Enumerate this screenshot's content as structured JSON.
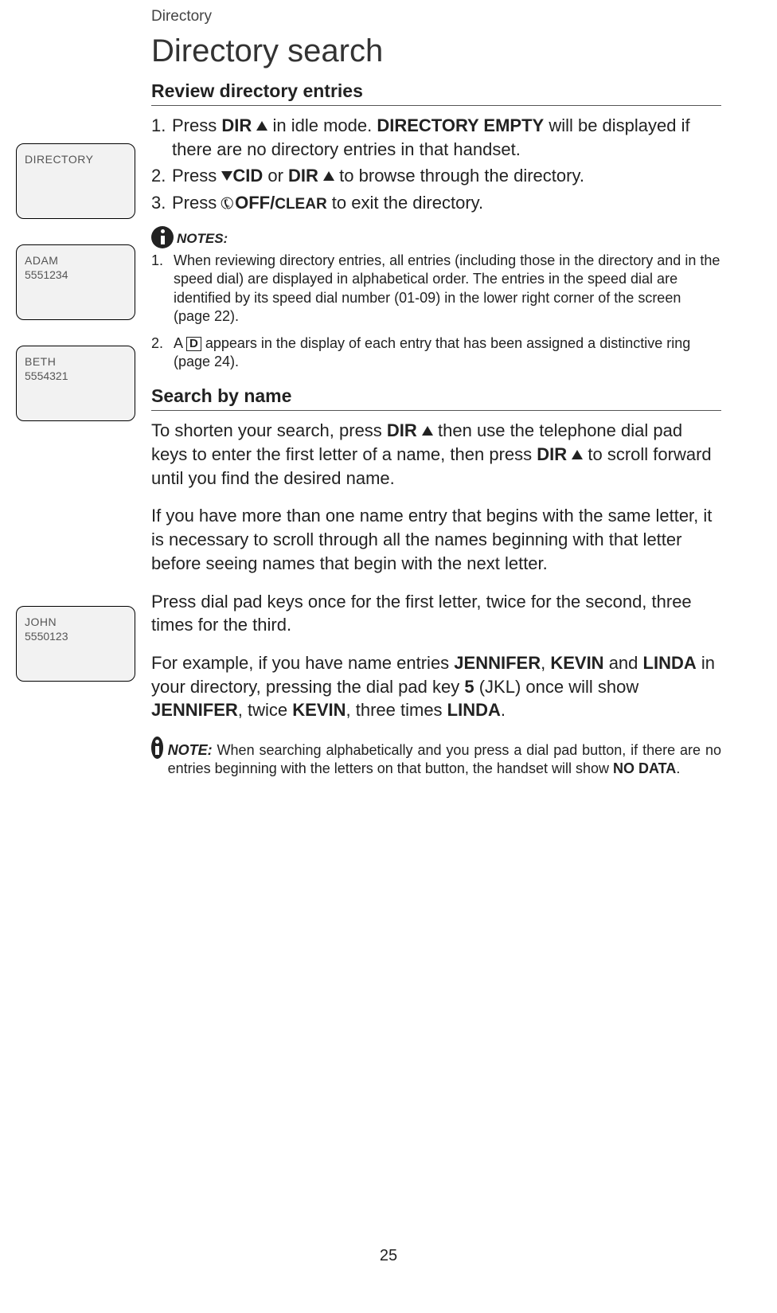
{
  "breadcrumb": "Directory",
  "page_title": "Directory search",
  "screens": [
    {
      "title": "DIRECTORY",
      "number": ""
    },
    {
      "title": "ADAM",
      "number": "5551234"
    },
    {
      "title": "BETH",
      "number": "5554321"
    },
    {
      "title": "JOHN",
      "number": "5550123"
    }
  ],
  "section1": {
    "heading": "Review directory entries",
    "step1_a": "Press ",
    "step1_dir": "DIR",
    "step1_b": " in idle mode. ",
    "step1_empty": "DIRECTORY EMPTY",
    "step1_c": " will be displayed if there are no directory entries in that handset.",
    "step2_a": "Press ",
    "step2_cid": "CID",
    "step2_b": " or ",
    "step2_dir": "DIR",
    "step2_c": " to browse through the directory.",
    "step3_a": "Press ",
    "step3_off": "OFF/",
    "step3_clear": "CLEAR",
    "step3_b": " to exit the directory."
  },
  "notes1": {
    "label": "NOTES:",
    "n1": "When reviewing directory entries, all entries (including those in the directory and in the speed dial) are displayed in alphabetical order. The entries in the speed dial are identified by its speed dial number (01-09) in the lower right corner of the screen (page 22).",
    "n2_a": "A ",
    "n2_d": "D",
    "n2_b": " appears in the display of each entry that has been assigned a distinctive ring (page 24)."
  },
  "section2": {
    "heading": "Search by name",
    "p1_a": "To shorten your search, press ",
    "p1_dir": "DIR",
    "p1_b": " then use the telephone dial pad keys to enter the first letter of a name, then press ",
    "p1_dir2": "DIR",
    "p1_c": " to scroll forward until you find the desired name.",
    "p2": "If you have more than one name entry that begins with the same letter, it is necessary to scroll through all the names beginning with that letter before seeing names that begin with the next letter.",
    "p3": "Press dial pad keys once for the first letter, twice for the second, three times for the third.",
    "p4_a": "For example, if you have name entries ",
    "p4_j": "JENNIFER",
    "p4_b": ", ",
    "p4_k": "KEVIN",
    "p4_c": " and ",
    "p4_l": "LINDA",
    "p4_d": " in your directory, pressing the dial pad key ",
    "p4_5": "5",
    "p4_e": " (JKL) once will show ",
    "p4_j2": "JENNIFER",
    "p4_f": ", twice ",
    "p4_k2": "KEVIN",
    "p4_g": ", three times ",
    "p4_l2": "LINDA",
    "p4_h": "."
  },
  "note2": {
    "lead": "NOTE:",
    "body_a": " When searching alphabetically and you press a dial pad button, if there are no entries beginning with the letters on that button, the handset will show ",
    "nodata": "NO DATA",
    "body_b": "."
  },
  "page_number": "25"
}
